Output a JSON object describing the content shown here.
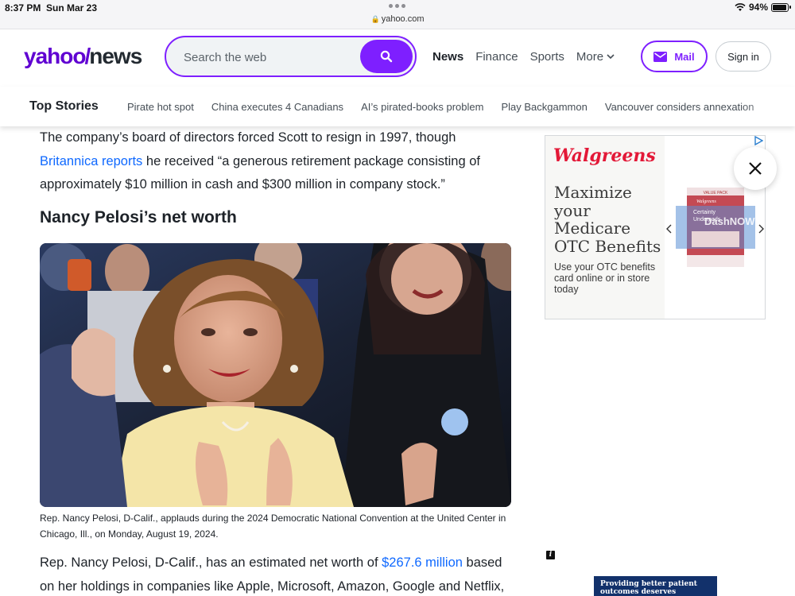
{
  "status_bar": {
    "time": "8:37 PM",
    "date": "Sun Mar 23",
    "url": "yahoo.com",
    "battery": "94%",
    "battery_level": 0.94
  },
  "header": {
    "logo_yahoo": "yahoo",
    "logo_slash": "/",
    "logo_news": "news",
    "search_placeholder": "Search the web",
    "nav": [
      "News",
      "Finance",
      "Sports",
      "More"
    ],
    "mail_label": "Mail",
    "signin_label": "Sign in"
  },
  "top_stories": {
    "title": "Top Stories",
    "links": [
      "Pirate hot spot",
      "China executes 4 Canadians",
      "AI’s pirated-books problem",
      "Play Backgammon",
      "Vancouver considers annexation"
    ]
  },
  "article": {
    "p1_before": "The company’s board of directors forced Scott to resign in 1997, though",
    "p1_link": "Britannica reports",
    "p1_after": " he received “a generous retirement package consisting of approximately $10 million in cash and $300 million in company stock.”",
    "heading": "Nancy Pelosi’s net worth",
    "caption": "Rep. Nancy Pelosi, D-Calif., applauds during the 2024 Democratic National Convention at the United Center in Chicago, Ill., on Monday, August 19, 2024.",
    "p2_before": "Rep. Nancy Pelosi, D-Calif., has an estimated net worth of ",
    "p2_link": "$267.6 million",
    "p2_after": " based on her holdings in companies like Apple, Microsoft, Amazon, Google and Netflix,"
  },
  "ad": {
    "brand": "Walgreens",
    "headline": "Maximize your Medicare OTC Benefits",
    "sub": "Use your OTC benefits card online or in store today",
    "product_label_1": "Walgreens",
    "product_label_2": "Certainty",
    "product_label_3": "Underpads",
    "product_label_4": "DashNOW",
    "product_label_5": "VALUE PACK"
  },
  "ad2": {
    "text": "Providing better patient outcomes deserves recognition."
  },
  "colors": {
    "brand_purple": "#7e1fff",
    "link_blue": "#0f69ff",
    "walgreens_red": "#e31837"
  }
}
